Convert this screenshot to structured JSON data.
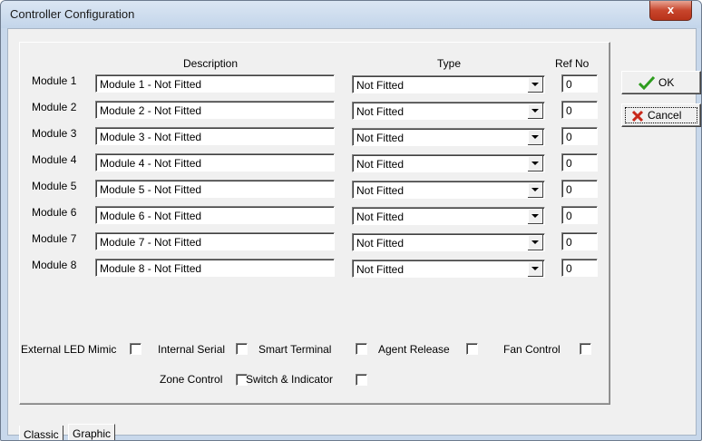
{
  "window": {
    "title": "Controller Configuration",
    "close_glyph": "x"
  },
  "headers": {
    "description": "Description",
    "type": "Type",
    "ref_no": "Ref No"
  },
  "modules": [
    {
      "label": "Module 1",
      "description": "Module 1 - Not Fitted",
      "type": "Not Fitted",
      "ref_no": "0"
    },
    {
      "label": "Module 2",
      "description": "Module 2 - Not Fitted",
      "type": "Not Fitted",
      "ref_no": "0"
    },
    {
      "label": "Module 3",
      "description": "Module 3 - Not Fitted",
      "type": "Not Fitted",
      "ref_no": "0"
    },
    {
      "label": "Module 4",
      "description": "Module 4 - Not Fitted",
      "type": "Not Fitted",
      "ref_no": "0"
    },
    {
      "label": "Module 5",
      "description": "Module 5 - Not Fitted",
      "type": "Not Fitted",
      "ref_no": "0"
    },
    {
      "label": "Module 6",
      "description": "Module 6 - Not Fitted",
      "type": "Not Fitted",
      "ref_no": "0"
    },
    {
      "label": "Module 7",
      "description": "Module 7 - Not Fitted",
      "type": "Not Fitted",
      "ref_no": "0"
    },
    {
      "label": "Module 8",
      "description": "Module 8 - Not Fitted",
      "type": "Not Fitted",
      "ref_no": "0"
    }
  ],
  "options": {
    "external_led_mimic": {
      "label": "External LED Mimic",
      "checked": false
    },
    "internal_serial": {
      "label": "Internal Serial",
      "checked": false
    },
    "smart_terminal": {
      "label": "Smart Terminal",
      "checked": false
    },
    "agent_release": {
      "label": "Agent Release",
      "checked": false
    },
    "fan_control": {
      "label": "Fan Control",
      "checked": false
    },
    "zone_control": {
      "label": "Zone Control",
      "checked": false
    },
    "switch_indicator": {
      "label": "Switch & Indicator",
      "checked": false
    }
  },
  "buttons": {
    "ok": "OK",
    "cancel": "Cancel"
  },
  "icons": {
    "ok": "check-icon",
    "cancel": "x-icon",
    "ok_color": "#2e9d1e",
    "cancel_color": "#c8281a"
  },
  "tabs": [
    {
      "label": "Classic",
      "active": true
    },
    {
      "label": "Graphic",
      "active": false
    }
  ]
}
